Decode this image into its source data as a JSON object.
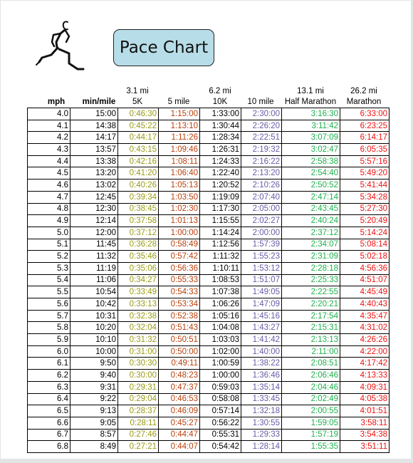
{
  "title": "Pace Chart",
  "colors": {
    "title_box_bg": "#b7dde8",
    "5k": "#9a9a16",
    "5mile": "#b8400c",
    "10k": "#000000",
    "10mile": "#6a5aa6",
    "half_marathon": "#1db04c",
    "marathon": "#ee1111"
  },
  "headers": {
    "mph": "mph",
    "min_mile": "min/mile",
    "5k_top": "3.1 mi",
    "5k": "5K",
    "5mile": "5 mile",
    "10k_top": "6.2 mi",
    "10k": "10K",
    "10mile": "10 mile",
    "half_top": "13.1 mi",
    "half": "Half Marathon",
    "marathon_top": "26.2 mi",
    "marathon": "Marathon"
  },
  "rows": [
    [
      "4.0",
      "15:00",
      "0:46:30",
      "1:15:00",
      "1:33:00",
      "2:30:00",
      "3:16:30",
      "6:33:00"
    ],
    [
      "4.1",
      "14:38",
      "0:45:22",
      "1:13:10",
      "1:30:44",
      "2:26:20",
      "3:11:42",
      "6:23:25"
    ],
    [
      "4.2",
      "14:17",
      "0:44:17",
      "1:11:26",
      "1:28:34",
      "2:22:51",
      "3:07:09",
      "6:14:17"
    ],
    [
      "4.3",
      "13:57",
      "0:43:15",
      "1:09:46",
      "1:26:31",
      "2:19:32",
      "3:02:47",
      "6:05:35"
    ],
    [
      "4.4",
      "13:38",
      "0:42:16",
      "1:08:11",
      "1:24:33",
      "2:16:22",
      "2:58:38",
      "5:57:16"
    ],
    [
      "4.5",
      "13:20",
      "0:41:20",
      "1:06:40",
      "1:22:40",
      "2:13:20",
      "2:54:40",
      "5:49:20"
    ],
    [
      "4.6",
      "13:02",
      "0:40:26",
      "1:05:13",
      "1:20:52",
      "2:10:26",
      "2:50:52",
      "5:41:44"
    ],
    [
      "4.7",
      "12:45",
      "0:39:34",
      "1:03:50",
      "1:19:09",
      "2:07:40",
      "2:47:14",
      "5:34:28"
    ],
    [
      "4.8",
      "12:30",
      "0:38:45",
      "1:02:30",
      "1:17:30",
      "2:05:00",
      "2:43:45",
      "5:27:30"
    ],
    [
      "4.9",
      "12:14",
      "0:37:58",
      "1:01:13",
      "1:15:55",
      "2:02:27",
      "2:40:24",
      "5:20:49"
    ],
    [
      "5.0",
      "12:00",
      "0:37:12",
      "1:00:00",
      "1:14:24",
      "2:00:00",
      "2:37:12",
      "5:14:24"
    ],
    [
      "5.1",
      "11:45",
      "0:36:28",
      "0:58:49",
      "1:12:56",
      "1:57:39",
      "2:34:07",
      "5:08:14"
    ],
    [
      "5.2",
      "11:32",
      "0:35:46",
      "0:57:42",
      "1:11:32",
      "1:55:23",
      "2:31:09",
      "5:02:18"
    ],
    [
      "5.3",
      "11:19",
      "0:35:06",
      "0:56:36",
      "1:10:11",
      "1:53:12",
      "2:28:18",
      "4:56:36"
    ],
    [
      "5.4",
      "11:06",
      "0:34:27",
      "0:55:33",
      "1:08:53",
      "1:51:07",
      "2:25:33",
      "4:51:07"
    ],
    [
      "5.5",
      "10:54",
      "0:33:49",
      "0:54:33",
      "1:07:38",
      "1:49:05",
      "2:22:55",
      "4:45:49"
    ],
    [
      "5.6",
      "10:42",
      "0:33:13",
      "0:53:34",
      "1:06:26",
      "1:47:09",
      "2:20:21",
      "4:40:43"
    ],
    [
      "5.7",
      "10:31",
      "0:32:38",
      "0:52:38",
      "1:05:16",
      "1:45:16",
      "2:17:54",
      "4:35:47"
    ],
    [
      "5.8",
      "10:20",
      "0:32:04",
      "0:51:43",
      "1:04:08",
      "1:43:27",
      "2:15:31",
      "4:31:02"
    ],
    [
      "5.9",
      "10:10",
      "0:31:32",
      "0:50:51",
      "1:03:03",
      "1:41:42",
      "2:13:13",
      "4:26:26"
    ],
    [
      "6.0",
      "10:00",
      "0:31:00",
      "0:50:00",
      "1:02:00",
      "1:40:00",
      "2:11:00",
      "4:22:00"
    ],
    [
      "6.1",
      "9:50",
      "0:30:30",
      "0:49:11",
      "1:00:59",
      "1:38:22",
      "2:08:51",
      "4:17:42"
    ],
    [
      "6.2",
      "9:40",
      "0:30:00",
      "0:48:23",
      "1:00:00",
      "1:36:46",
      "2:06:46",
      "4:13:33"
    ],
    [
      "6.3",
      "9:31",
      "0:29:31",
      "0:47:37",
      "0:59:03",
      "1:35:14",
      "2:04:46",
      "4:09:31"
    ],
    [
      "6.4",
      "9:22",
      "0:29:04",
      "0:46:53",
      "0:58:08",
      "1:33:45",
      "2:02:49",
      "4:05:38"
    ],
    [
      "6.5",
      "9:13",
      "0:28:37",
      "0:46:09",
      "0:57:14",
      "1:32:18",
      "2:00:55",
      "4:01:51"
    ],
    [
      "6.6",
      "9:05",
      "0:28:11",
      "0:45:27",
      "0:56:22",
      "1:30:55",
      "1:59:05",
      "3:58:11"
    ],
    [
      "6.7",
      "8:57",
      "0:27:46",
      "0:44:47",
      "0:55:31",
      "1:29:33",
      "1:57:19",
      "3:54:38"
    ],
    [
      "6.8",
      "8:49",
      "0:27:21",
      "0:44:07",
      "0:54:42",
      "1:28:14",
      "1:55:35",
      "3:51:11"
    ]
  ]
}
